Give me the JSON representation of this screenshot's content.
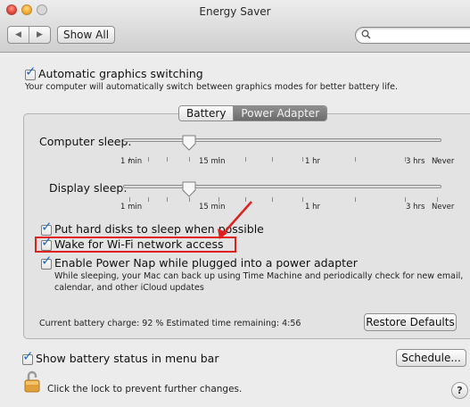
{
  "window": {
    "title": "Energy Saver"
  },
  "toolbar": {
    "back_glyph": "◀",
    "forward_glyph": "▶",
    "show_all": "Show All",
    "search_placeholder": "",
    "search_glyph": "🔍"
  },
  "graphics": {
    "checked": true,
    "label": "Automatic graphics switching",
    "description": "Your computer will automatically switch between graphics modes for better battery life."
  },
  "tabs": {
    "battery": "Battery",
    "power_adapter": "Power Adapter",
    "selected": "Power Adapter"
  },
  "computer_sleep": {
    "label": "Computer sleep:",
    "value": "15 min",
    "tick_labels": [
      "1 min",
      "15 min",
      "1 hr",
      "3 hrs",
      "Never"
    ]
  },
  "display_sleep": {
    "label": "Display sleep:",
    "value": "15 min",
    "tick_labels": [
      "1 min",
      "15 min",
      "1 hr",
      "3 hrs",
      "Never"
    ]
  },
  "options": {
    "hard_disks": {
      "checked": true,
      "label": "Put hard disks to sleep when possible"
    },
    "wake_wifi": {
      "checked": true,
      "label": "Wake for Wi-Fi network access"
    },
    "power_nap": {
      "checked": true,
      "label": "Enable Power Nap while plugged into a power adapter",
      "description_line1": "While sleeping, your Mac can back up using Time Machine and periodically check for new email,",
      "description_line2": "calendar, and other iCloud updates"
    }
  },
  "battery_status": "Current battery charge: 92 %  Estimated time remaining: 4:56",
  "buttons": {
    "restore_defaults": "Restore Defaults",
    "schedule": "Schedule...",
    "help": "?"
  },
  "menu_bar": {
    "checked": true,
    "label": "Show battery status in menu bar"
  },
  "lock": {
    "label": "Click the lock to prevent further changes."
  },
  "annotation": {
    "highlight_color": "#e0201c"
  },
  "colors": {
    "checkmark": "#1c6fd4",
    "tab_selected": "#7a7a7a"
  }
}
